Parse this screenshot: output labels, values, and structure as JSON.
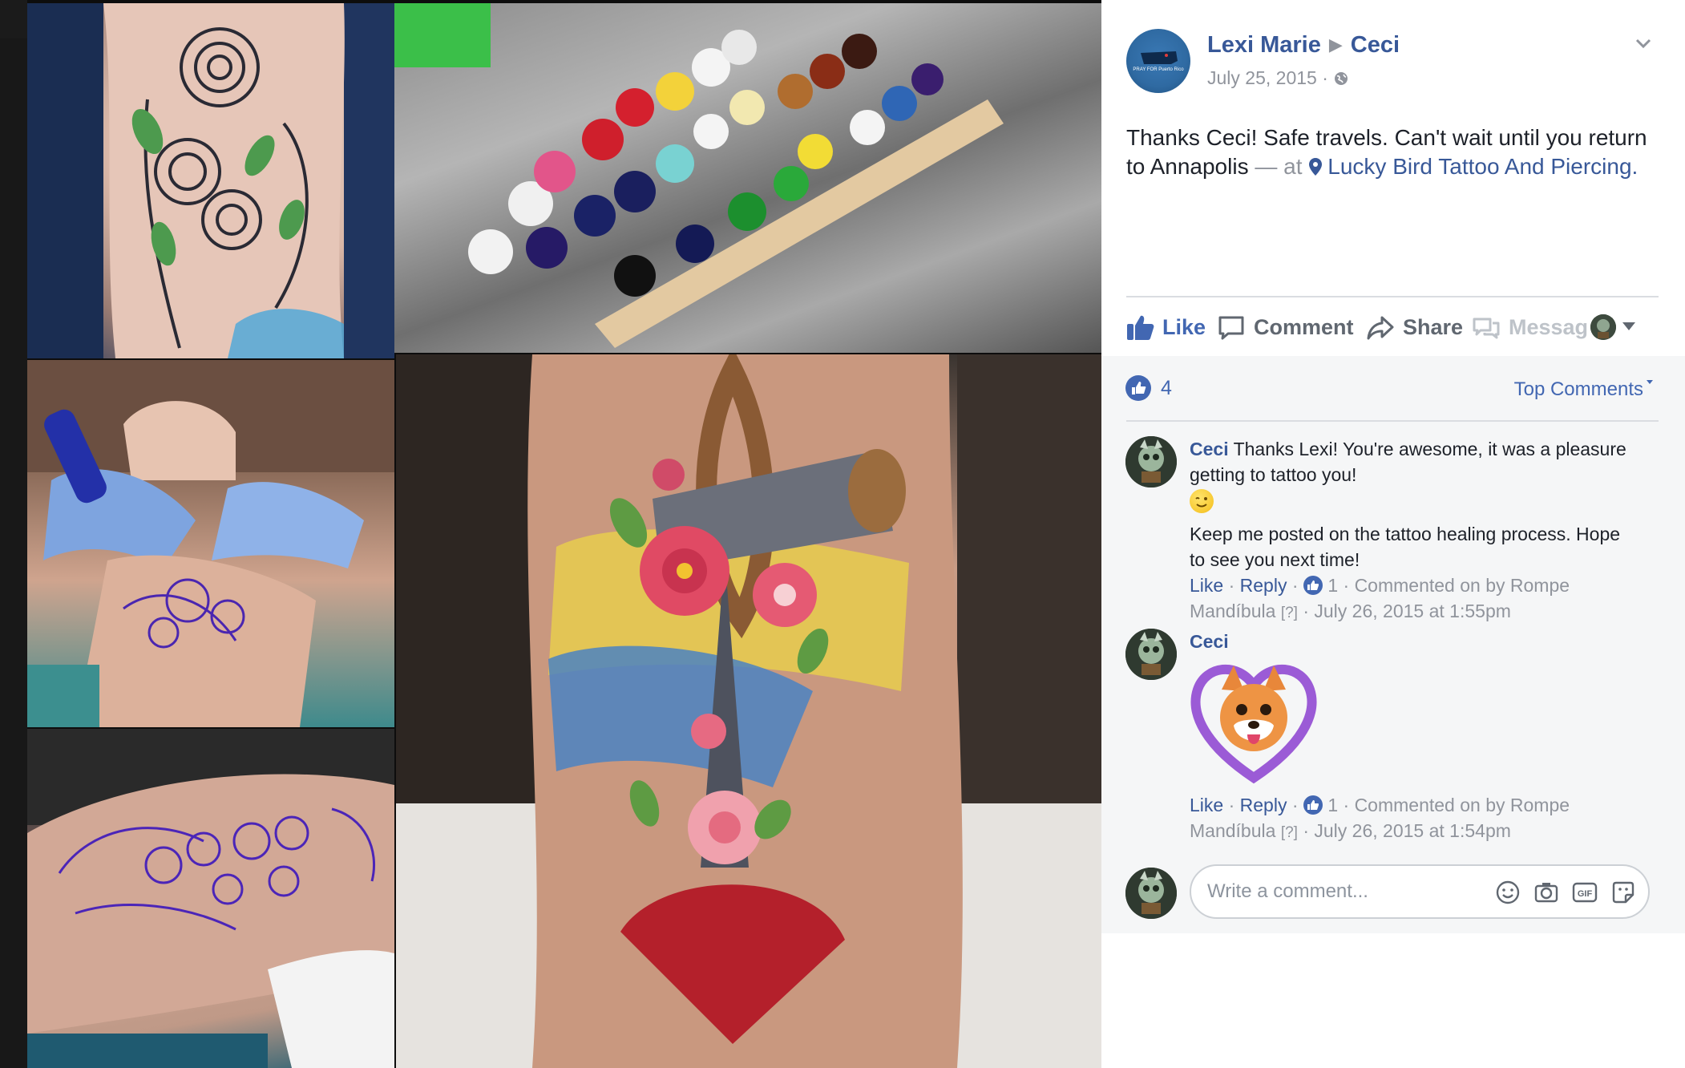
{
  "post": {
    "author": "Lexi Marie",
    "target": "Ceci",
    "date": "July 25, 2015",
    "text_main": "Thanks Ceci! Safe travels. Can't wait until you return to Annapolis",
    "text_at": " — at ",
    "place": "Lucky Bird Tattoo And Piercing.",
    "page_avatar_text": "PRAY FOR Puerto Rico"
  },
  "actions": {
    "like": "Like",
    "comment": "Comment",
    "share": "Share",
    "message": "Messag"
  },
  "reactions": {
    "count": "4",
    "sort_label": "Top Comments"
  },
  "comments": [
    {
      "author": "Ceci",
      "text_line1": " Thanks Lexi! You're awesome, it was a pleasure getting to tattoo you!",
      "text_line2": "Keep me posted on the tattoo healing process. Hope to see you next time!",
      "like_label": "Like",
      "reply_label": "Reply",
      "like_count": "1",
      "meta": "Commented on by Rompe Mandíbula",
      "tag": "[?]",
      "timestamp": "July 26, 2015 at 1:55pm"
    },
    {
      "author": "Ceci",
      "like_label": "Like",
      "reply_label": "Reply",
      "like_count": "1",
      "meta": "Commented on by Rompe Mandíbula",
      "tag": "[?]",
      "timestamp": "July 26, 2015 at 1:54pm"
    }
  ],
  "composer": {
    "placeholder": "Write a comment..."
  },
  "icons": {
    "like": "thumbs-up-icon",
    "comment": "speech-bubble-icon",
    "share": "share-arrow-icon",
    "message": "messenger-icon",
    "location": "map-pin-icon",
    "privacy": "globe-icon",
    "menu": "chevron-down-icon",
    "emoji": "smiley-icon",
    "camera": "camera-icon",
    "gif": "gif-icon",
    "sticker": "sticker-icon"
  },
  "colors": {
    "link_blue": "#385898",
    "action_blue": "#4267b2",
    "muted_gray": "#90949c",
    "text": "#1d2129"
  }
}
